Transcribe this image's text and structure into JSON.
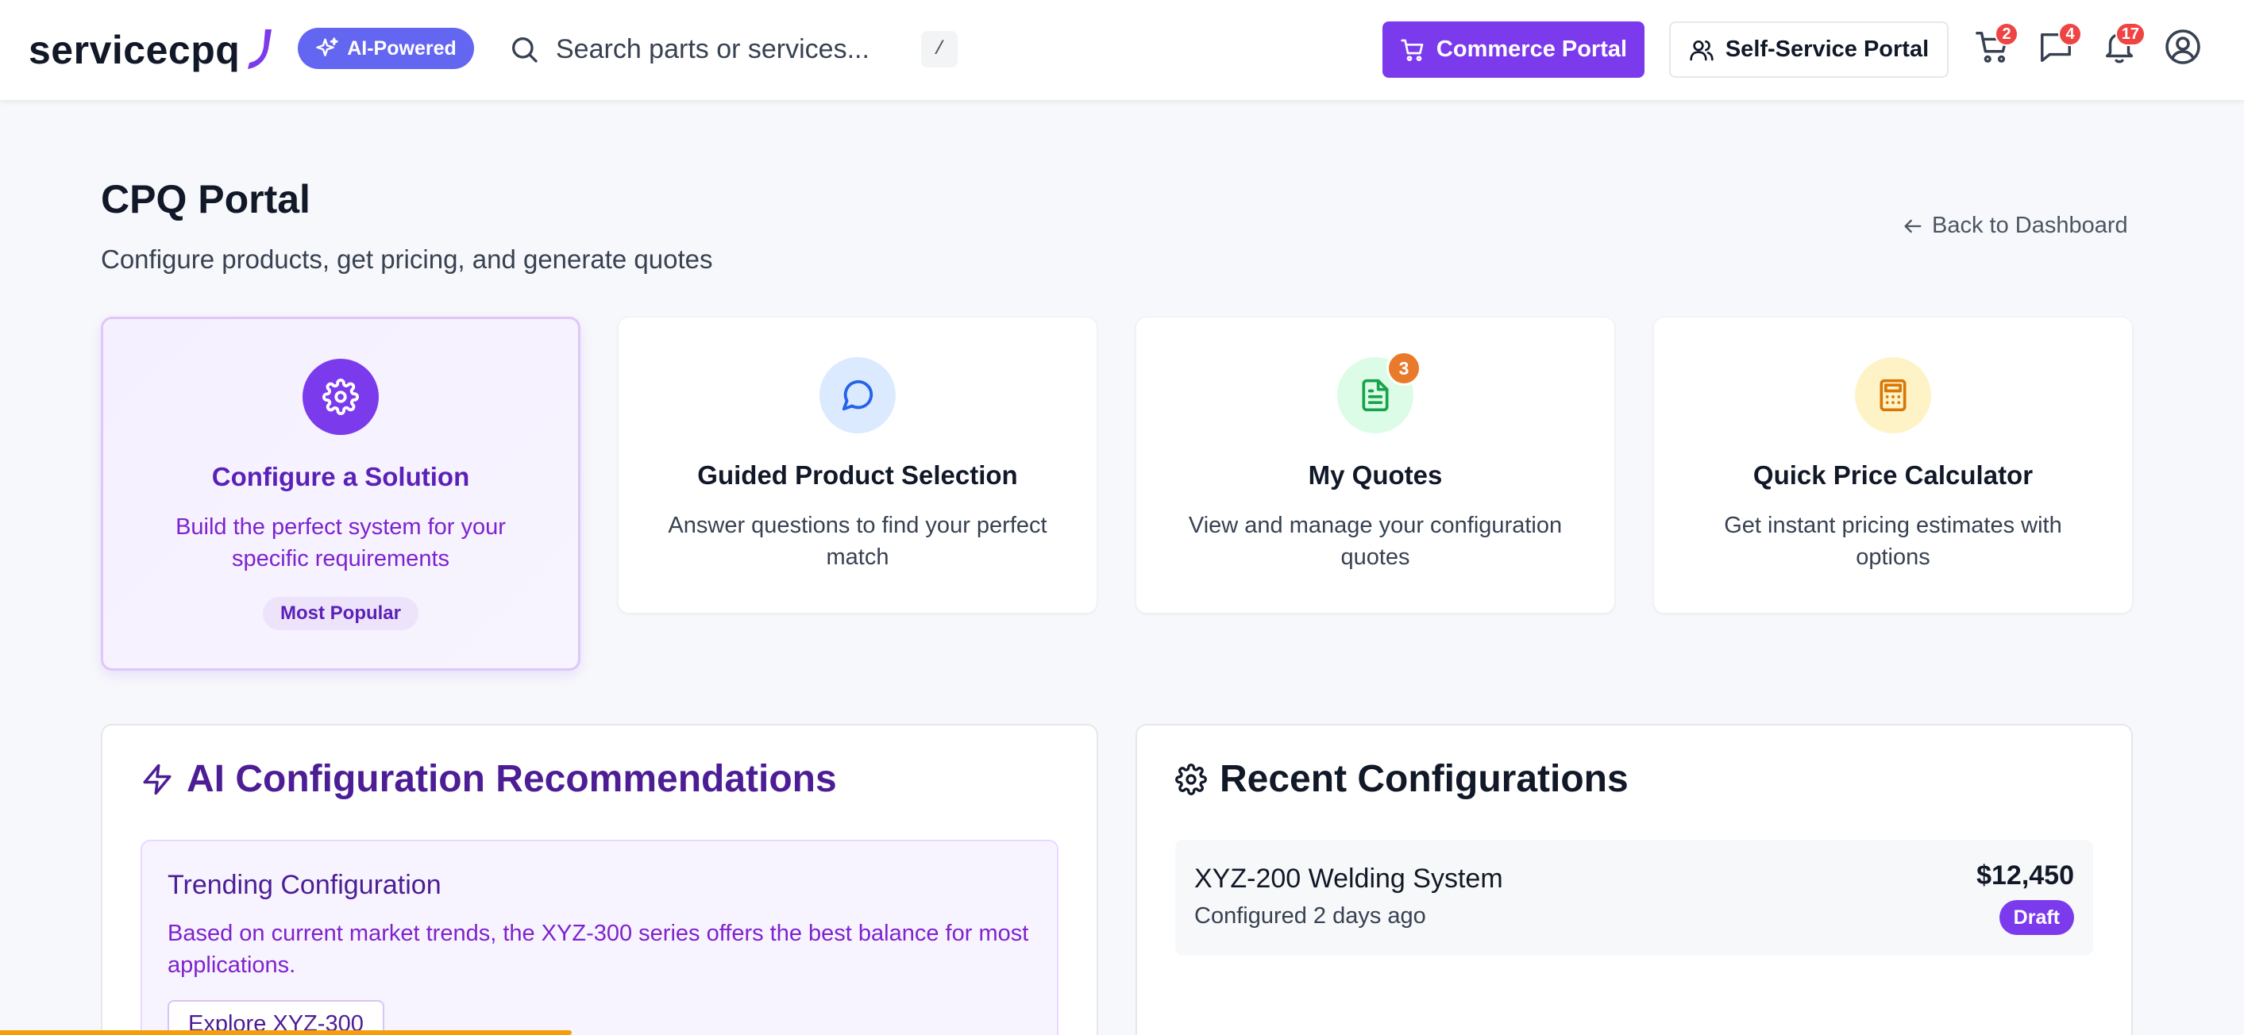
{
  "header": {
    "logo_text": "servicecpq",
    "ai_badge_label": "AI-Powered",
    "search_placeholder": "Search parts or services...",
    "search_shortcut": "/",
    "commerce_portal_label": "Commerce Portal",
    "self_service_label": "Self-Service Portal",
    "cart_count": "2",
    "messages_count": "4",
    "notifications_count": "17"
  },
  "page": {
    "title": "CPQ Portal",
    "subtitle": "Configure products, get pricing, and generate quotes",
    "back_link": "Back to Dashboard"
  },
  "cards": [
    {
      "title": "Configure a Solution",
      "description": "Build the perfect system for your specific requirements",
      "tag": "Most Popular",
      "icon": "gear-icon",
      "icon_bg": "#7c3aed"
    },
    {
      "title": "Guided Product Selection",
      "description": "Answer questions to find your perfect match",
      "icon": "chat-bubble-icon",
      "icon_bg": "#dbeafe"
    },
    {
      "title": "My Quotes",
      "description": "View and manage your configuration quotes",
      "badge": "3",
      "icon": "document-icon",
      "icon_bg": "#dcfce7"
    },
    {
      "title": "Quick Price Calculator",
      "description": "Get instant pricing estimates with options",
      "icon": "calculator-icon",
      "icon_bg": "#fef3c7"
    }
  ],
  "ai_recommendations": {
    "title": "AI Configuration Recommendations",
    "trending_title": "Trending Configuration",
    "trending_text": "Based on current market trends, the XYZ-300 series offers the best balance for most applications.",
    "explore_label": "Explore XYZ-300"
  },
  "recent_configurations": {
    "title": "Recent Configurations",
    "items": [
      {
        "name": "XYZ-200 Welding System",
        "time": "Configured 2 days ago",
        "price": "$12,450",
        "status": "Draft"
      }
    ]
  },
  "colors": {
    "accent": "#7c3aed",
    "ai_badge": "#6366f1",
    "notification_red": "#ef4444",
    "quote_badge": "#ea7a2b"
  }
}
